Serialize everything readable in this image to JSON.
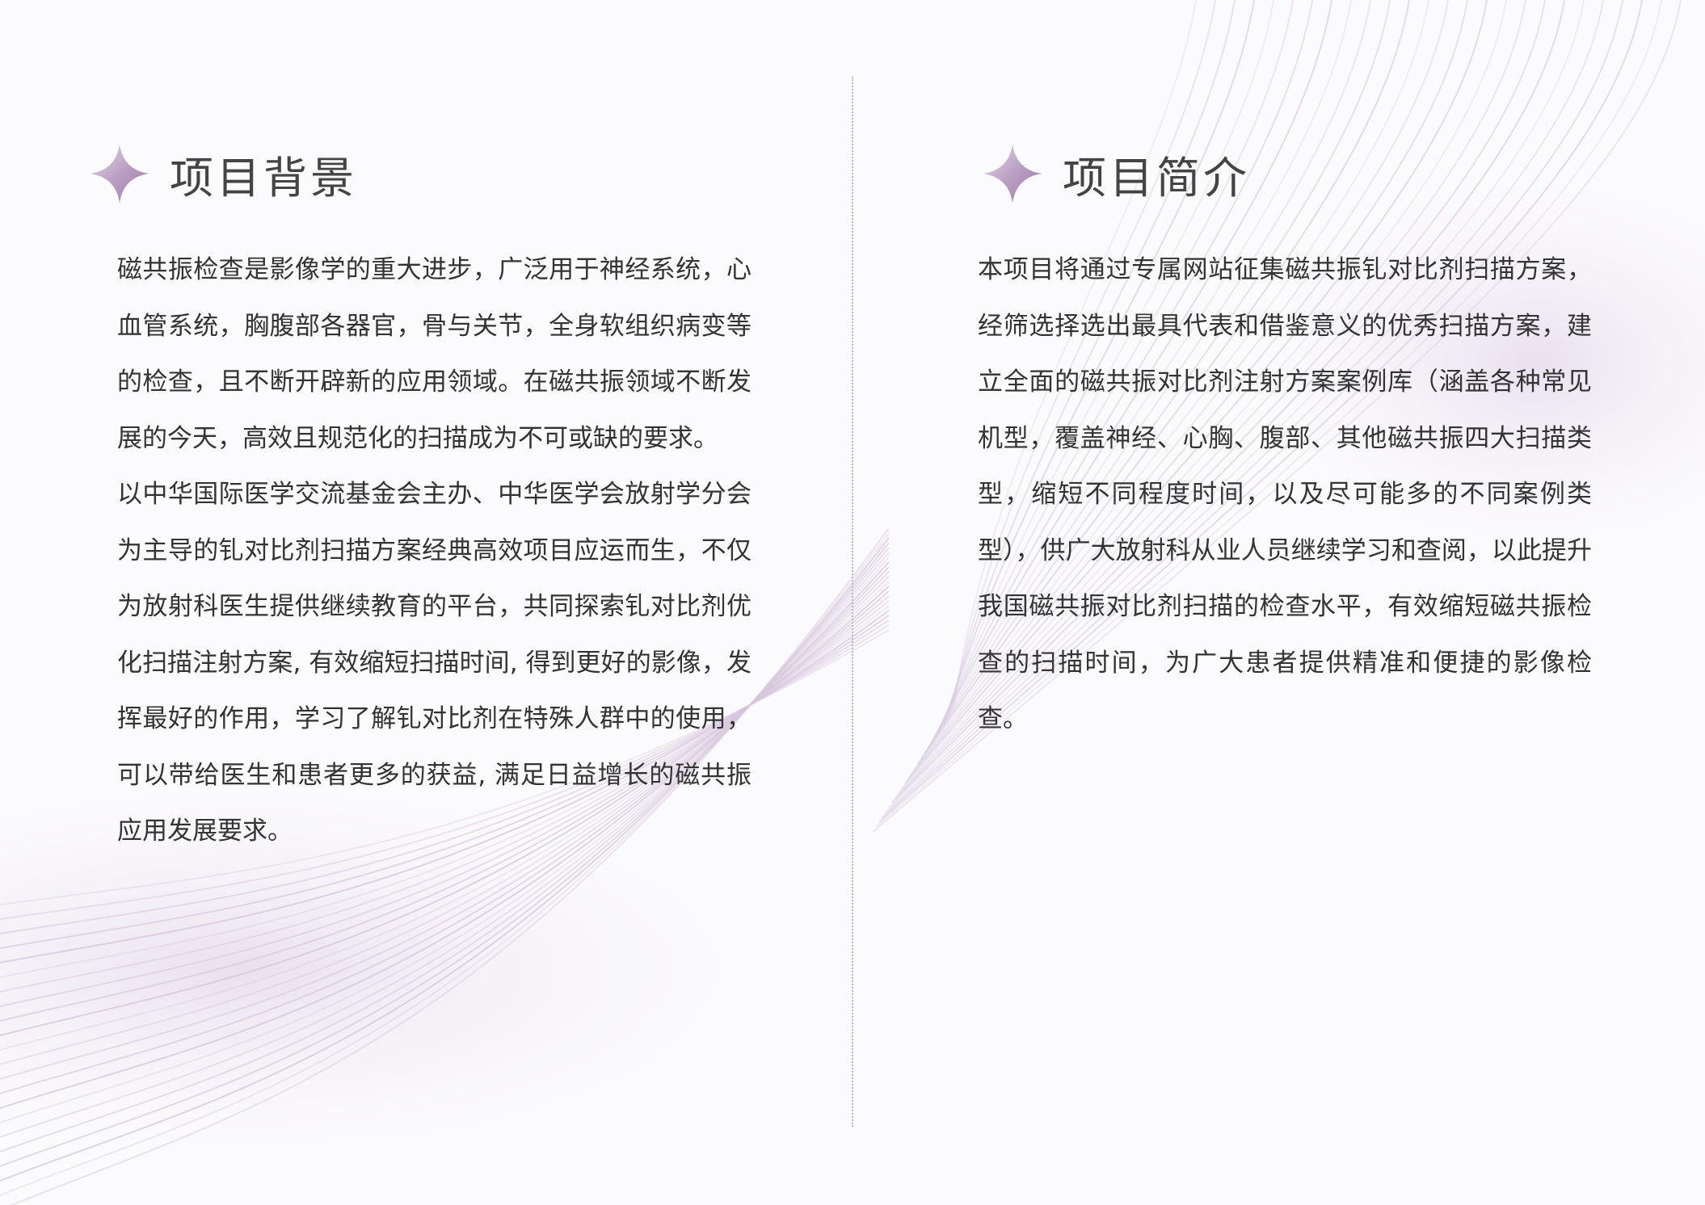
{
  "colors": {
    "accent": "#a98fb2",
    "line": "#cdb9d4",
    "text": "#333333",
    "heading": "#444444",
    "background": "#fbfafc"
  },
  "left_section": {
    "icon": "four-point-star-icon",
    "title": "项目背景",
    "paragraphs": [
      "磁共振检查是影像学的重大进步，广泛用于神经系统，心血管系统，胸腹部各器官，骨与关节，全身软组织病变等的检查，且不断开辟新的应用领域。在磁共振领域不断发展的今天，高效且规范化的扫描成为不可或缺的要求。",
      "以中华国际医学交流基金会主办、中华医学会放射学分会为主导的钆对比剂扫描方案经典高效项目应运而生，不仅为放射科医生提供继续教育的平台，共同探索钆对比剂优化扫描注射方案, 有效缩短扫描时间, 得到更好的影像，发挥最好的作用，学习了解钆对比剂在特殊人群中的使用，可以带给医生和患者更多的获益, 满足日益增长的磁共振应用发展要求。"
    ]
  },
  "right_section": {
    "icon": "four-point-star-icon",
    "title": "项目简介",
    "paragraphs": [
      "本项目将通过专属网站征集磁共振钆对比剂扫描方案，经筛选择选出最具代表和借鉴意义的优秀扫描方案，建立全面的磁共振对比剂注射方案案例库（涵盖各种常见机型，覆盖神经、心胸、腹部、其他磁共振四大扫描类型，缩短不同程度时间，以及尽可能多的不同案例类型），供广大放射科从业人员继续学习和查阅，以此提升我国磁共振对比剂扫描的检查水平，有效缩短磁共振检查的扫描时间，为广大患者提供精准和便捷的影像检查。"
    ]
  }
}
